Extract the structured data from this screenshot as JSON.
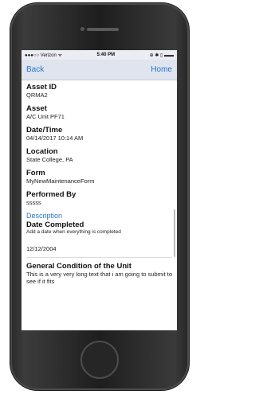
{
  "status": {
    "carrier": "●●●○○ Verizon ᯤ",
    "time": "5:40 PM",
    "icons": "⊕ ✱ ▯ ▬▬"
  },
  "nav": {
    "back": "Back",
    "home": "Home"
  },
  "fields": [
    {
      "label": "Asset ID",
      "value": "QRMA2"
    },
    {
      "label": "Asset",
      "value": "A/C Unit PF71"
    },
    {
      "label": "Date/Time",
      "value": "04/14/2017 10:14 AM"
    },
    {
      "label": "Location",
      "value": "State College, PA"
    },
    {
      "label": "Form",
      "value": "MyNewMaintenanceForm"
    },
    {
      "label": "Performed By",
      "value": "sssss"
    }
  ],
  "description": {
    "section_title": "Description",
    "date_completed_label": "Date Completed",
    "date_completed_hint": "Add a date when everything is completed",
    "date_completed_value": "12/12/2004",
    "condition_label": "General Condition of the Unit",
    "condition_value": "This is a very very long text that i am going to submit to see if it fits"
  }
}
